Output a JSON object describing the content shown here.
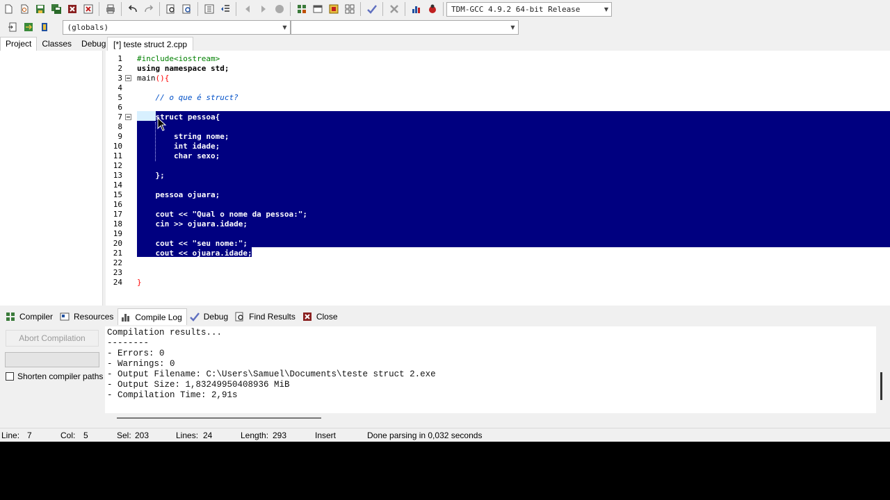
{
  "toolbar": {
    "compiler_combo": "TDM-GCC 4.9.2 64-bit Release",
    "globals_combo": "(globals)",
    "members_combo": ""
  },
  "left_tabs": [
    "Project",
    "Classes",
    "Debug"
  ],
  "editor": {
    "tab_title": "[*] teste struct 2.cpp",
    "line_numbers": [
      "1",
      "2",
      "3",
      "4",
      "5",
      "6",
      "7",
      "8",
      "9",
      "10",
      "11",
      "12",
      "13",
      "14",
      "15",
      "16",
      "17",
      "18",
      "19",
      "20",
      "21",
      "22",
      "23",
      "24"
    ],
    "lines": [
      {
        "t": "#include<iostream>",
        "c": "pp"
      },
      {
        "t": "using namespace std;",
        "c": "kw"
      },
      {
        "t": "main(){",
        "c": "main"
      },
      {
        "t": "",
        "c": ""
      },
      {
        "t": "    // o que é struct?",
        "c": "cm"
      },
      {
        "t": "",
        "c": ""
      },
      {
        "t": "    struct pessoa{",
        "c": "sel"
      },
      {
        "t": "",
        "c": "sel"
      },
      {
        "t": "        string nome;",
        "c": "sel"
      },
      {
        "t": "        int idade;",
        "c": "sel"
      },
      {
        "t": "        char sexo;",
        "c": "sel"
      },
      {
        "t": "",
        "c": "sel"
      },
      {
        "t": "    };",
        "c": "sel"
      },
      {
        "t": "",
        "c": "sel"
      },
      {
        "t": "    pessoa ojuara;",
        "c": "sel"
      },
      {
        "t": "",
        "c": "sel"
      },
      {
        "t": "    cout << \"Qual o nome da pessoa:\";",
        "c": "sel"
      },
      {
        "t": "    cin >> ojuara.idade;",
        "c": "sel"
      },
      {
        "t": "",
        "c": "sel"
      },
      {
        "t": "    cout << \"seu nome:\";",
        "c": "sel"
      },
      {
        "t": "    cout << ojuara.idade;",
        "c": "sel"
      },
      {
        "t": "",
        "c": ""
      },
      {
        "t": "",
        "c": ""
      },
      {
        "t": "}",
        "c": "br"
      }
    ]
  },
  "bottom_tabs": [
    "Compiler",
    "Resources",
    "Compile Log",
    "Debug",
    "Find Results",
    "Close"
  ],
  "compile_panel": {
    "abort_label": "Abort Compilation",
    "shorten_label": "Shorten compiler paths",
    "log": [
      "Compilation results...",
      "--------",
      "- Errors: 0",
      "- Warnings: 0",
      "- Output Filename: C:\\Users\\Samuel\\Documents\\teste struct 2.exe",
      "- Output Size: 1,83249950408936 MiB",
      "- Compilation Time: 2,91s"
    ]
  },
  "status": {
    "line_label": "Line:",
    "line_value": "7",
    "col_label": "Col:",
    "col_value": "5",
    "sel_label": "Sel:",
    "sel_value": "203",
    "lines_label": "Lines:",
    "lines_value": "24",
    "length_label": "Length:",
    "length_value": "293",
    "mode": "Insert",
    "message": "Done parsing in 0,032 seconds"
  },
  "colors": {
    "selection": "#000080",
    "preprocessor": "#008000",
    "comment": "#0050c8",
    "brace": "#ff0000"
  }
}
